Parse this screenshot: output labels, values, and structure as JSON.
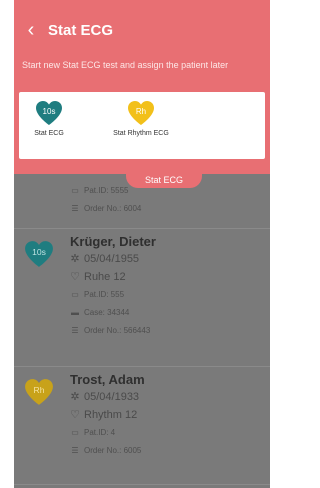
{
  "header": {
    "title": "Stat ECG",
    "back_glyph": "‹"
  },
  "subtitle": "Start new Stat ECG test and assign the patient later",
  "tiles": [
    {
      "badge": "10s",
      "label": "Stat ECG",
      "color": "#1f7d80"
    },
    {
      "badge": "Rh",
      "label": "Stat Rhythm ECG",
      "color": "#f2c01a"
    }
  ],
  "tab_label": "Stat ECG",
  "patients": [
    {
      "pat_id": "Pat.ID: 5555",
      "order": "Order No.: 6004"
    },
    {
      "badge": "10s",
      "name": "Krüger, Dieter",
      "dob": "05/04/1955",
      "test": "Ruhe 12",
      "pat_id": "Pat.ID: 555",
      "case": "Case: 34344",
      "order": "Order No.: 566443"
    },
    {
      "badge": "Rh",
      "name": "Trost, Adam",
      "dob": "05/04/1933",
      "test": "Rhythm 12",
      "pat_id": "Pat.ID: 4",
      "order": "Order No.: 6005"
    }
  ],
  "colors": {
    "accent": "#e86f73",
    "teal": "#1f7d80",
    "yellow": "#f2c01a"
  }
}
